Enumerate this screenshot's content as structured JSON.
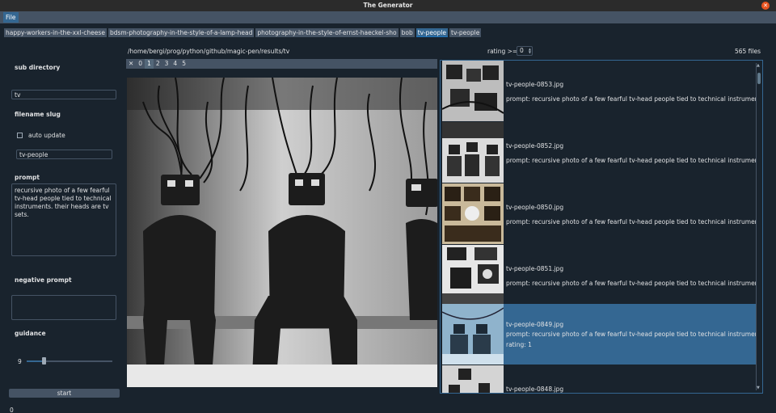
{
  "window": {
    "title": "The Generator"
  },
  "menu": {
    "file": "File"
  },
  "tabs": [
    {
      "label": "happy-workers-in-the-xxl-cheese"
    },
    {
      "label": "bdsm-photography-in-the-style-of-a-lamp-head"
    },
    {
      "label": "photography-in-the-style-of-ernst-haeckel-sho"
    },
    {
      "label": "bob"
    },
    {
      "label": "tv-people",
      "active": true
    },
    {
      "label": "tv-people"
    }
  ],
  "left": {
    "sub_directory_label": "sub directory",
    "sub_directory_value": "tv",
    "slug_label": "filename slug",
    "auto_update_label": "auto update",
    "slug_value": "tv-people",
    "prompt_label": "prompt",
    "prompt_value": "recursive photo of a few fearful tv-head people tied to technical instruments. their heads are tv sets.",
    "negative_label": "negative prompt",
    "negative_value": "",
    "guidance_label": "guidance",
    "guidance_value": "9",
    "guidance_fraction": 0.2,
    "start_label": "start"
  },
  "viewer": {
    "path": "/home/bergi/prog/python/github/magic-pen/results/tv",
    "rating_label": "rating >=",
    "rating_value": "0",
    "files_count": "565 files",
    "rating_buttons": [
      "✕",
      "0",
      "1",
      "2",
      "3",
      "4",
      "5"
    ],
    "active_rating": "1"
  },
  "files": [
    {
      "name": "tv-people-0853.jpg",
      "prompt": "prompt: recursive photo of a few fearful tv-head people tied to technical instruments. th..."
    },
    {
      "name": "tv-people-0852.jpg",
      "prompt": "prompt: recursive photo of a few fearful tv-head people tied to technical instruments. th..."
    },
    {
      "name": "tv-people-0850.jpg",
      "prompt": "prompt: recursive photo of a few fearful tv-head people tied to technical instruments. th..."
    },
    {
      "name": "tv-people-0851.jpg",
      "prompt": "prompt: recursive photo of a few fearful tv-head people tied to technical instruments. th..."
    },
    {
      "name": "tv-people-0849.jpg",
      "prompt": "prompt: recursive photo of a few fearful tv-head people tied to technical instruments. th...",
      "rating": "rating: 1",
      "selected": true
    },
    {
      "name": "tv-people-0848.jpg",
      "prompt": ""
    }
  ],
  "status": {
    "text": "0"
  },
  "colors": {
    "bg": "#19232d",
    "panel": "#455364",
    "accent": "#346792",
    "close": "#e95420"
  },
  "icons": {
    "close": "close-icon",
    "scroll_up": "chevron-up-icon",
    "scroll_down": "chevron-down-icon"
  }
}
